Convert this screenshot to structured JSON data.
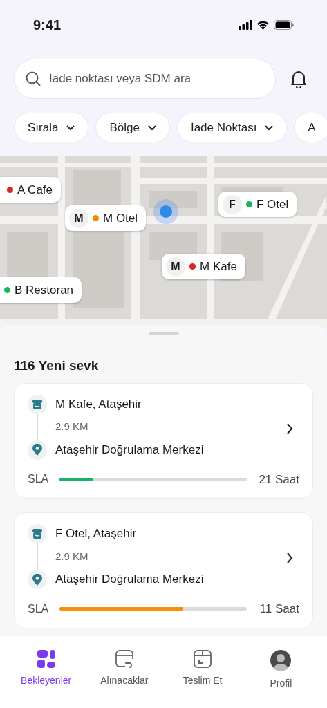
{
  "status_bar": {
    "time": "9:41"
  },
  "search": {
    "placeholder": "İade noktası veya SDM ara"
  },
  "filters": [
    {
      "label": "Sırala",
      "dropdown": true
    },
    {
      "label": "Bölge",
      "dropdown": true
    },
    {
      "label": "İade Noktası",
      "dropdown": true
    },
    {
      "label": "A",
      "dropdown": false
    }
  ],
  "map": {
    "pins": [
      {
        "label": "A Cafe",
        "color": "#dc2626"
      },
      {
        "badge": "M",
        "label": "M Otel",
        "color": "#f08c00"
      },
      {
        "badge": "F",
        "label": "F Otel",
        "color": "#16b364"
      },
      {
        "badge": "M",
        "label": "M Kafe",
        "color": "#dc2626"
      },
      {
        "label": "B Restoran",
        "color": "#16b364"
      }
    ]
  },
  "section_title": "116 Yeni sevk",
  "shipments": [
    {
      "origin": "M Kafe, Ataşehir",
      "distance": "2.9 KM",
      "destination": "Ataşehir Doğrulama Merkezi",
      "sla_label": "SLA",
      "level": 0.18,
      "color": "#16b364",
      "remaining": "21 Saat"
    },
    {
      "origin": "F Otel, Ataşehir",
      "distance": "2.9 KM",
      "destination": "Ataşehir Doğrulama Merkezi",
      "sla_label": "SLA",
      "level": 0.66,
      "color": "#f79009",
      "remaining": "11 Saat"
    }
  ],
  "tabs": [
    {
      "label": "Bekleyenler",
      "kind": "grid",
      "selected": true
    },
    {
      "label": "Alınacaklar",
      "kind": "return",
      "selected": false
    },
    {
      "label": "Teslim Et",
      "kind": "box",
      "selected": false
    },
    {
      "label": "Profil",
      "kind": "avatar",
      "selected": false
    }
  ]
}
